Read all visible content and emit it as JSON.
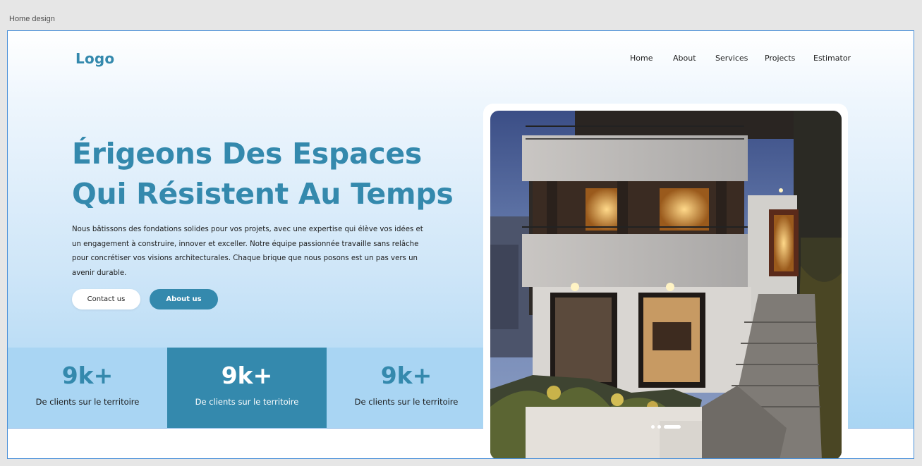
{
  "frame": {
    "label": "Home design"
  },
  "header": {
    "logo": "Logo",
    "nav": [
      "Home",
      "About",
      "Services",
      "Projects",
      "Estimator"
    ]
  },
  "hero": {
    "headline_line1": "Érigeons Des Espaces",
    "headline_line2": "Qui Résistent Au Temps",
    "paragraph": "Nous bâtissons des fondations solides pour vos projets, avec une expertise qui élève vos idées et un engagement à construire, innover et exceller. Notre équipe passionnée travaille sans relâche pour concrétiser vos visions architecturales. Chaque brique que nous posons est un pas vers un avenir durable.",
    "buttons": {
      "contact": "Contact us",
      "about": "About us"
    }
  },
  "stats": [
    {
      "value": "9k+",
      "label": "De clients sur le territoire"
    },
    {
      "value": "9k+",
      "label": "De clients sur le territoire"
    },
    {
      "value": "9k+",
      "label": "De clients sur le territoire"
    }
  ],
  "carousel": {
    "active_index": 2,
    "count": 3
  },
  "colors": {
    "primary": "#3489ad",
    "hero_bottom": "#a9d5f3",
    "selection": "#4a90d9"
  }
}
